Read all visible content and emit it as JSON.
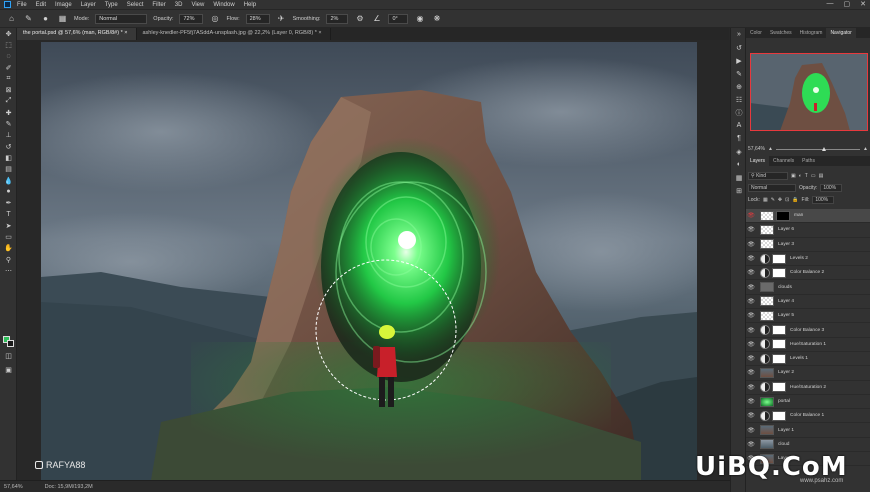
{
  "menu": [
    "File",
    "Edit",
    "Image",
    "Layer",
    "Type",
    "Select",
    "Filter",
    "3D",
    "View",
    "Window",
    "Help"
  ],
  "window_controls": [
    "—",
    "▢",
    "✕"
  ],
  "options": {
    "mode_label": "Mode:",
    "mode_value": "Normal",
    "opacity_label": "Opacity:",
    "opacity_value": "72%",
    "flow_label": "Flow:",
    "flow_value": "28%",
    "smoothing_label": "Smoothing:",
    "smoothing_value": "2%",
    "angle_value": "0°"
  },
  "doc_tabs": [
    {
      "label": "the portal.psd @ 57,6% (man, RGB/8#) *",
      "active": true
    },
    {
      "label": "ashley-knedler-PF5fj7ASddA-unsplash.jpg @ 22,2% (Layer 0, RGB/8) *",
      "active": false
    }
  ],
  "status": {
    "zoom": "57,64%",
    "doc": "Doc: 15,9M/193,2M"
  },
  "credit": "RAFYA88",
  "panel_tabs_top": [
    {
      "label": "Color",
      "active": false
    },
    {
      "label": "Swatches",
      "active": false
    },
    {
      "label": "Histogram",
      "active": false
    },
    {
      "label": "Navigator",
      "active": true
    }
  ],
  "navigator_zoom": "57,64%",
  "panel_tabs_layers": [
    {
      "label": "Layers",
      "active": true
    },
    {
      "label": "Channels",
      "active": false
    },
    {
      "label": "Paths",
      "active": false
    }
  ],
  "layers_controls": {
    "kind": "Kind",
    "blend": "Normal",
    "opacity_label": "Opacity:",
    "opacity_value": "100%",
    "lock_label": "Lock:",
    "fill_label": "Fill:",
    "fill_value": "100%"
  },
  "layers": [
    {
      "name": "man",
      "type": "pixel",
      "selected": true,
      "thumb": "checker"
    },
    {
      "name": "Layer 6",
      "type": "pixel",
      "selected": false,
      "thumb": "checker"
    },
    {
      "name": "Layer 3",
      "type": "pixel",
      "selected": false,
      "thumb": "checker"
    },
    {
      "name": "Levels 2",
      "type": "adjust",
      "selected": false,
      "thumb": "adjust"
    },
    {
      "name": "Color Balance 2",
      "type": "adjust",
      "selected": false,
      "thumb": "adjust"
    },
    {
      "name": "clouds",
      "type": "pixel",
      "selected": false,
      "thumb": "gray"
    },
    {
      "name": "Layer 4",
      "type": "pixel",
      "selected": false,
      "thumb": "checker"
    },
    {
      "name": "Layer 5",
      "type": "pixel",
      "selected": false,
      "thumb": "checker"
    },
    {
      "name": "Color Balance 3",
      "type": "adjust",
      "selected": false,
      "thumb": "adjust"
    },
    {
      "name": "Hue/Saturation 1",
      "type": "adjust",
      "selected": false,
      "thumb": "adjust"
    },
    {
      "name": "Levels 1",
      "type": "adjust",
      "selected": false,
      "thumb": "adjust"
    },
    {
      "name": "Layer 2",
      "type": "pixel",
      "selected": false,
      "thumb": "photo"
    },
    {
      "name": "Hue/Saturation 2",
      "type": "adjust",
      "selected": false,
      "thumb": "adjust"
    },
    {
      "name": "portal",
      "type": "pixel",
      "selected": false,
      "thumb": "green"
    },
    {
      "name": "Color Balance 1",
      "type": "adjust",
      "selected": false,
      "thumb": "adjust"
    },
    {
      "name": "Layer 1",
      "type": "pixel",
      "selected": false,
      "thumb": "photo"
    },
    {
      "name": "cloud",
      "type": "pixel",
      "selected": false,
      "thumb": "sky"
    },
    {
      "name": "Layer 0",
      "type": "pixel",
      "selected": false,
      "thumb": "photo"
    }
  ],
  "watermark": "UiBQ.CoM",
  "watermark_url": "www.psahz.com",
  "colors": {
    "foreground": "#2fbf5a",
    "background": "#1a1a1a",
    "nav_frame": "#e8393d",
    "portal": "#39ff6a"
  }
}
